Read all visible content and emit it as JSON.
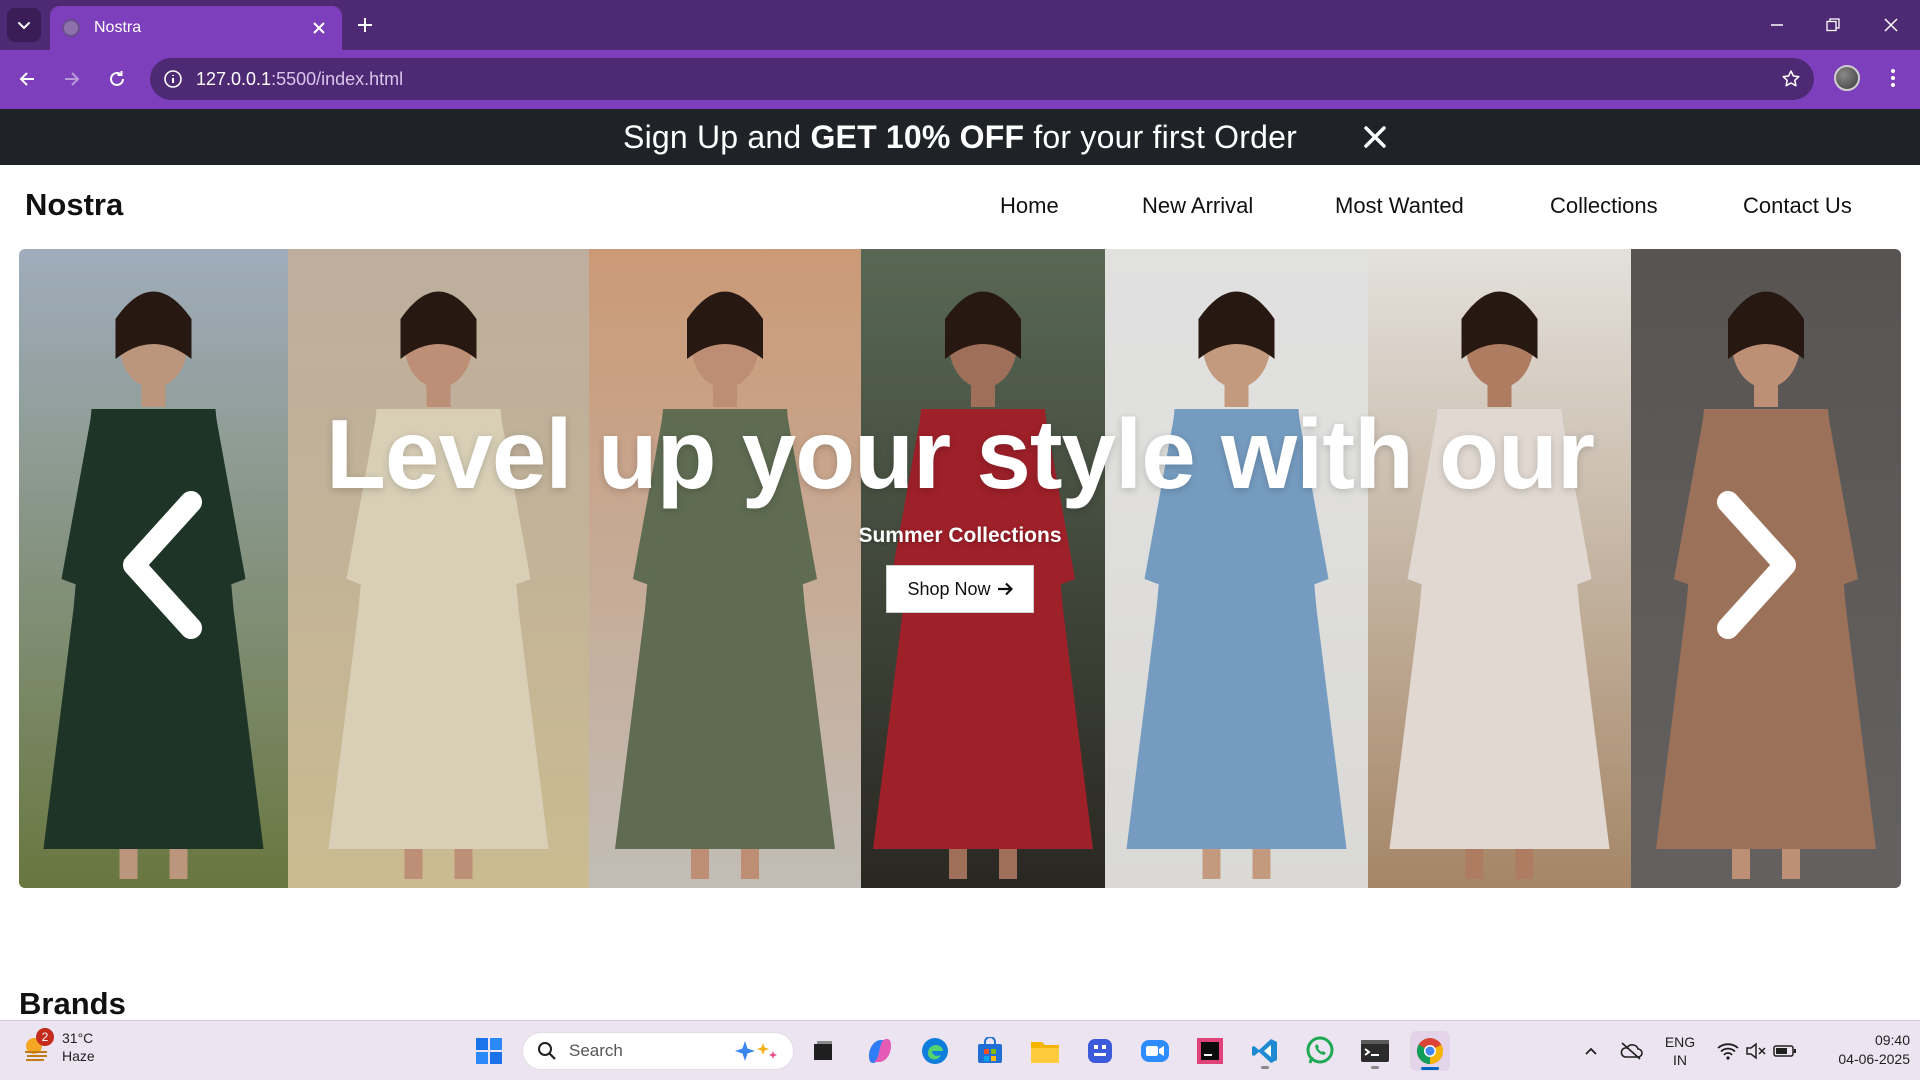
{
  "browser": {
    "tab_title": "Nostra",
    "url_host": "127.0.0.1",
    "url_rest": ":5500/index.html"
  },
  "promo": {
    "prefix": "Sign Up and ",
    "highlight": "GET 10% OFF",
    "suffix": " for your first Order"
  },
  "header": {
    "logo": "Nostra",
    "nav": [
      "Home",
      "New Arrival",
      "Most Wanted",
      "Collections",
      "Contact Us"
    ]
  },
  "hero": {
    "title": "Level up your style with our",
    "subtitle": "Summer Collections",
    "cta": "Shop Now",
    "panels": [
      {
        "bg_top": "#aab8c8",
        "bg_bottom": "#6f7f44",
        "outfit": "#20382a",
        "skin": "#c89f85"
      },
      {
        "bg_top": "#c9b9a8",
        "bg_bottom": "#d8c79a",
        "outfit": "#e6dcc2",
        "skin": "#c8987e"
      },
      {
        "bg_top": "#d8a37e",
        "bg_bottom": "#cfc9c2",
        "outfit": "#657358",
        "skin": "#c9977c"
      },
      {
        "bg_top": "#5f6f5a",
        "bg_bottom": "#2c2a24",
        "outfit": "#a8232c",
        "skin": "#a9765f"
      },
      {
        "bg_top": "#f0f0ef",
        "bg_bottom": "#e8e7e4",
        "outfit": "#7da6cc",
        "skin": "#d1a487"
      },
      {
        "bg_top": "#f2efea",
        "bg_bottom": "#b08f6d",
        "outfit": "#eee6df",
        "skin": "#b88468"
      },
      {
        "bg_top": "#5d5a58",
        "bg_bottom": "#6b6766",
        "outfit": "#a57a5f",
        "skin": "#c9987d"
      }
    ]
  },
  "brands": {
    "heading": "Brands"
  },
  "taskbar": {
    "weather_temp": "31°C",
    "weather_desc": "Haze",
    "weather_badge": "2",
    "search_label": "Search",
    "lang_top": "ENG",
    "lang_bottom": "IN",
    "time": "09:40",
    "date": "04-06-2025"
  },
  "colors": {
    "tabbar": "#4f2a74",
    "toolbar": "#7d3fbc",
    "promo_bg": "#1f2226",
    "taskbar": "#ede4f1"
  }
}
